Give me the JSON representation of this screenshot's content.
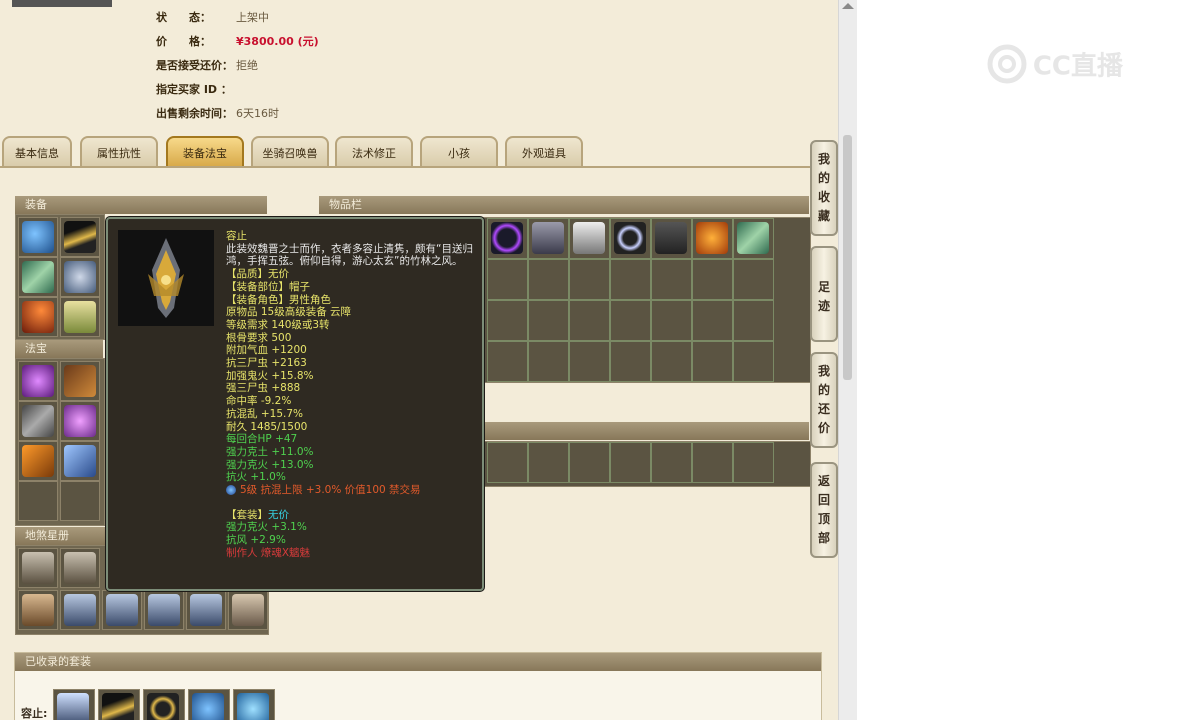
{
  "info": {
    "status_label": "状　　态：",
    "status": "上架中",
    "price_label": "价　　格：",
    "price": "¥3800.00 (元)",
    "accept_label": "是否接受还价：",
    "accept": "拒绝",
    "buyer_label": "指定买家 ID ：",
    "buyer": "",
    "remain_label": "出售剩余时间：",
    "remain": "6天16时"
  },
  "tabs": [
    "基本信息",
    "属性抗性",
    "装备法宝",
    "坐骑召唤兽",
    "法术修正",
    "小孩",
    "外观道具"
  ],
  "active_tab": 2,
  "panels": {
    "equip": "装备",
    "fabao": "法宝",
    "book": "地煞星册",
    "inventory": "物品栏",
    "suits": "已收录的套装",
    "suit_row_label": "容止:"
  },
  "tooltip": {
    "name": "容止",
    "desc": "此装效魏晋之士而作，衣者多容止清隽，颇有“目送归鸿，手挥五弦。俯仰自得，游心太玄”的竹林之风。",
    "lines": [
      {
        "t": "【品质】无价",
        "c": "y"
      },
      {
        "t": "【装备部位】帽子",
        "c": "y"
      },
      {
        "t": "【装备角色】男性角色",
        "c": "y"
      },
      {
        "t": "原物品 15级高级装备 云障",
        "c": "y"
      },
      {
        "t": "等级需求 140级或3转",
        "c": "y"
      },
      {
        "t": "根骨要求 500",
        "c": "y"
      },
      {
        "t": "附加气血 +1200",
        "c": "y"
      },
      {
        "t": "抗三尸虫 +2163",
        "c": "y"
      },
      {
        "t": "加强鬼火 +15.8%",
        "c": "y"
      },
      {
        "t": "强三尸虫 +888",
        "c": "y"
      },
      {
        "t": "命中率 -9.2%",
        "c": "y"
      },
      {
        "t": "抗混乱 +15.7%",
        "c": "y"
      },
      {
        "t": "耐久 1485/1500",
        "c": "y"
      },
      {
        "t": "每回合HP +47",
        "c": "g"
      },
      {
        "t": "强力克土 +11.0%",
        "c": "g"
      },
      {
        "t": "强力克火 +13.0%",
        "c": "g"
      },
      {
        "t": "抗火 +1.0%",
        "c": "g"
      }
    ],
    "gem": "5级 抗混上限 +3.0% 价值100 禁交易",
    "suit_label": "【套装】",
    "suit_value": "无价",
    "suit_lines": [
      "强力克火 +3.1%",
      "抗风 +2.9%"
    ],
    "maker": "制作人 燎魂X魑魅"
  },
  "side": [
    "我的收藏",
    "足迹",
    "我的还价",
    "返回顶部"
  ],
  "logo": "CC直播",
  "colors": {
    "accent": "#d8aa4a",
    "price": "#c8102e",
    "tooltip_bg": "#2f2a22"
  }
}
